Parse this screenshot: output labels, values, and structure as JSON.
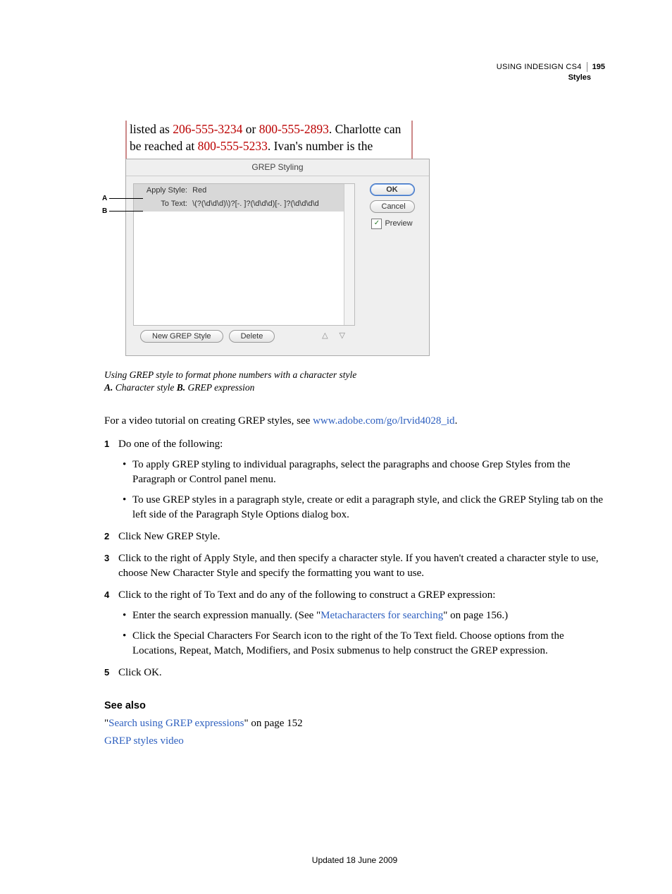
{
  "header": {
    "title": "USING INDESIGN CS4",
    "section": "Styles",
    "page": "195"
  },
  "figure": {
    "sample_prefix": "listed as ",
    "phone1": "206-555-3234",
    "sample_mid1": " or ",
    "phone2": "800-555-2893",
    "sample_mid2": ". Charlotte can be reached at ",
    "phone3": "800-555-5233",
    "sample_suffix": ". Ivan's number is the",
    "dialog_title": "GREP Styling",
    "row1_label": "Apply Style:",
    "row1_value": "Red",
    "row2_label": "To Text:",
    "row2_value": "\\(?(\\d\\d\\d)\\)?[-. ]?(\\d\\d\\d)[-. ]?(\\d\\d\\d\\d",
    "btn_new": "New GREP Style",
    "btn_delete": "Delete",
    "btn_ok": "OK",
    "btn_cancel": "Cancel",
    "preview_label": "Preview",
    "callout_a": "A",
    "callout_b": "B"
  },
  "caption": {
    "line1": "Using GREP style to format phone numbers with a character style",
    "a_bold": "A.",
    "a_text": " Character style  ",
    "b_bold": "B.",
    "b_text": " GREP expression"
  },
  "intro": {
    "text_before": "For a video tutorial on creating GREP styles, see ",
    "link": "www.adobe.com/go/lrvid4028_id",
    "text_after": "."
  },
  "steps": {
    "s1": "Do one of the following:",
    "s1b1": "To apply GREP styling to individual paragraphs, select the paragraphs and choose Grep Styles from the Paragraph or Control panel menu.",
    "s1b2": "To use GREP styles in a paragraph style, create or edit a paragraph style, and click the GREP Styling tab on the left side of the Paragraph Style Options dialog box.",
    "s2": "Click New GREP Style.",
    "s3": "Click to the right of Apply Style, and then specify a character style. If you haven't created a character style to use, choose New Character Style and specify the formatting you want to use.",
    "s4": "Click to the right of To Text and do any of the following to construct a GREP expression:",
    "s4b1_before": "Enter the search expression manually. (See \"",
    "s4b1_link": "Metacharacters for searching",
    "s4b1_after": "\" on page 156.)",
    "s4b2": "Click the Special Characters For Search icon to the right of the To Text field. Choose options from the Locations, Repeat, Match, Modifiers, and Posix submenus to help construct the GREP expression.",
    "s5": "Click OK."
  },
  "see_also": {
    "heading": "See also",
    "l1_before": "\"",
    "l1_link": "Search using GREP expressions",
    "l1_after": "\" on page 152",
    "l2_link": "GREP styles video"
  },
  "footer": "Updated 18 June 2009"
}
